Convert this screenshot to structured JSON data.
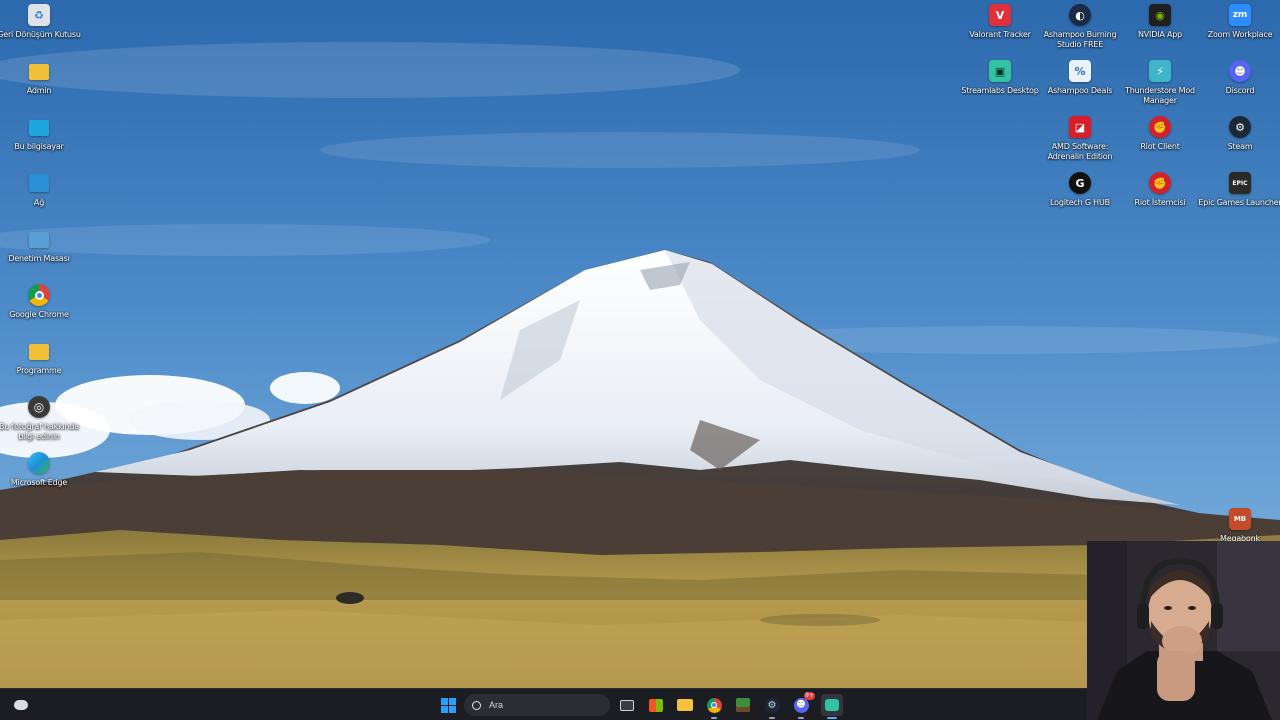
{
  "desktop": {
    "left_icons": [
      {
        "label": "Geri Dönüşüm Kutusu",
        "icon": "recycle-bin-icon",
        "color": "#d9dde3",
        "glyph": "♻"
      },
      {
        "label": "Admin",
        "icon": "folder-icon",
        "color": "#f2c037",
        "glyph": ""
      },
      {
        "label": "Bu bilgisayar",
        "icon": "computer-icon",
        "color": "#22a3d8",
        "glyph": ""
      },
      {
        "label": "Ağ",
        "icon": "network-icon",
        "color": "#2b8fd6",
        "glyph": ""
      },
      {
        "label": "Denetim Masası",
        "icon": "control-panel-icon",
        "color": "#5aa0d8",
        "glyph": ""
      },
      {
        "label": "Google Chrome",
        "icon": "chrome-icon",
        "color": "#db4437",
        "glyph": ""
      },
      {
        "label": "Programme",
        "icon": "folder-icon",
        "color": "#f2c037",
        "glyph": ""
      },
      {
        "label": "Bu fotoğraf hakkında bilgi edinin",
        "icon": "info-camera-icon",
        "color": "#4a4a4a",
        "glyph": "◎"
      },
      {
        "label": "Microsoft Edge",
        "icon": "edge-icon",
        "color": "#1ea0a6",
        "glyph": ""
      }
    ],
    "right_icons": [
      {
        "label": "Valorant Tracker",
        "icon": "valorant-tracker-icon",
        "color": "#e0303b",
        "glyph": "V"
      },
      {
        "label": "Ashampoo Burning Studio FREE",
        "icon": "ashampoo-burning-icon",
        "color": "#1a2b4a",
        "glyph": "◐"
      },
      {
        "label": "NVIDIA App",
        "icon": "nvidia-icon",
        "color": "#76b900",
        "glyph": "◉"
      },
      {
        "label": "Zoom Workplace",
        "icon": "zoom-icon",
        "color": "#2d8cff",
        "glyph": "zm"
      },
      {
        "label": "Streamlabs Desktop",
        "icon": "streamlabs-icon",
        "color": "#31c3a2",
        "glyph": "▣"
      },
      {
        "label": "Ashampoo Deals",
        "icon": "ashampoo-deals-icon",
        "color": "#e9f1fb",
        "glyph": "%"
      },
      {
        "label": "Thunderstore Mod Manager",
        "icon": "thunderstore-icon",
        "color": "#3fb5c9",
        "glyph": "⚡"
      },
      {
        "label": "Discord",
        "icon": "discord-icon",
        "color": "#5865f2",
        "glyph": "☻"
      },
      {
        "label": "AMD Software: Adrenalin Edition",
        "icon": "amd-icon",
        "color": "#d81e2a",
        "glyph": "◪"
      },
      {
        "label": "Riot Client",
        "icon": "riot-client-icon",
        "color": "#d4202c",
        "glyph": "✊"
      },
      {
        "label": "Steam",
        "icon": "steam-icon",
        "color": "#1b2838",
        "glyph": "⚙"
      },
      {
        "label": "Logitech G HUB",
        "icon": "logitech-ghub-icon",
        "color": "#111111",
        "glyph": "G"
      },
      {
        "label": "Riot İstemcisi",
        "icon": "riot-client-icon",
        "color": "#d4202c",
        "glyph": "✊"
      },
      {
        "label": "Epic Games Launcher",
        "icon": "epic-games-icon",
        "color": "#2a2a2a",
        "glyph": "EPIC"
      },
      {
        "label": "Megabonk",
        "icon": "megabonk-icon",
        "color": "#c44b2a",
        "glyph": "MB"
      }
    ]
  },
  "taskbar": {
    "search_placeholder": "Ara",
    "discord_badge": "9+",
    "apps": [
      {
        "name": "task-view",
        "icon": "task-view-icon"
      },
      {
        "name": "microsoft-store",
        "icon": "store-icon"
      },
      {
        "name": "file-explorer",
        "icon": "folder-icon"
      },
      {
        "name": "google-chrome",
        "icon": "chrome-icon"
      },
      {
        "name": "minecraft",
        "icon": "minecraft-icon"
      },
      {
        "name": "steam",
        "icon": "steam-icon"
      },
      {
        "name": "discord",
        "icon": "discord-icon"
      },
      {
        "name": "streamlabs",
        "icon": "streamlabs-icon"
      }
    ],
    "accent": "#0b82e6"
  }
}
